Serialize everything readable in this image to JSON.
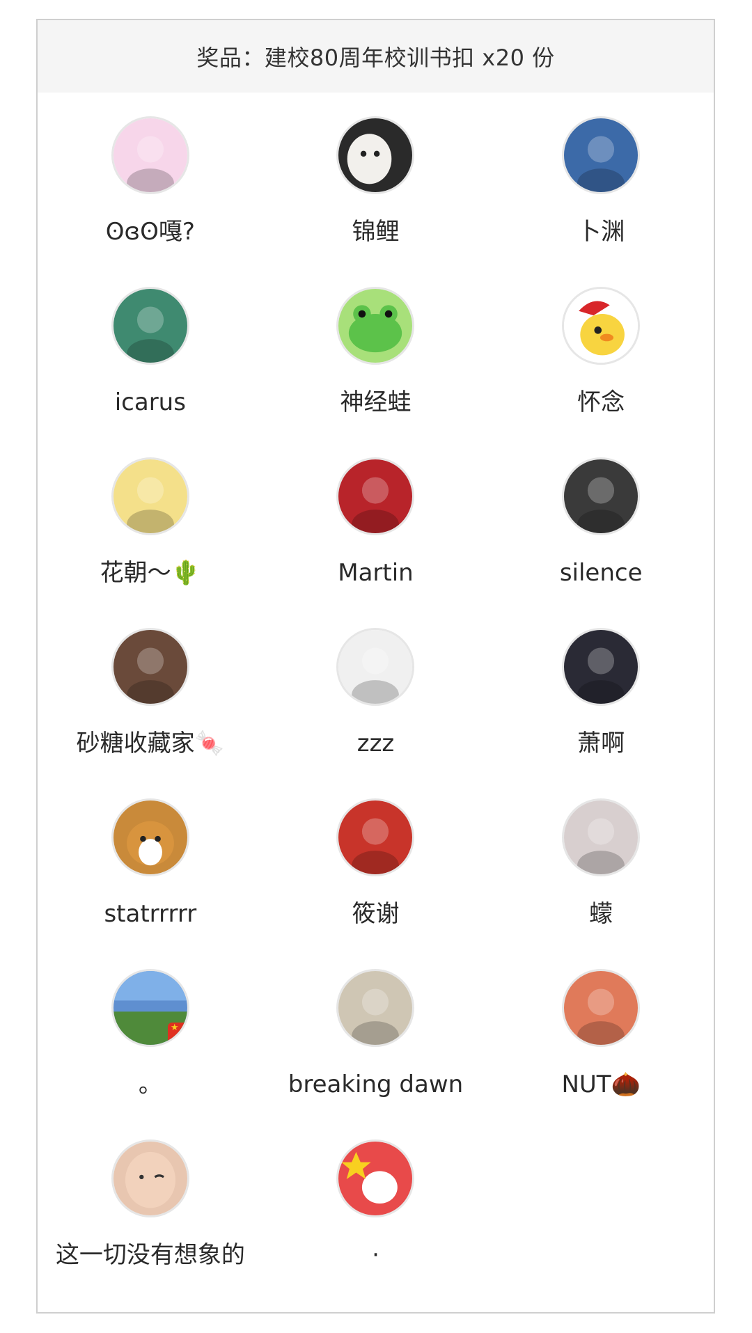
{
  "prize": {
    "text": "奖品：建校80周年校训书扣 x20 份"
  },
  "winners": [
    {
      "name": "ʘɞʘ嘎?",
      "avatar_icon": "anime-stickers-avatar",
      "avatar_color": "#f7d6ea"
    },
    {
      "name": "锦鲤",
      "avatar_icon": "white-cat-avatar",
      "avatar_color": "#2a2a2a"
    },
    {
      "name": "卜渊",
      "avatar_icon": "floating-tower-avatar",
      "avatar_color": "#3c6aa8"
    },
    {
      "name": "icarus",
      "avatar_icon": "anime-boy-avatar",
      "avatar_color": "#3f8a70"
    },
    {
      "name": "神经蛙",
      "avatar_icon": "green-frog-avatar",
      "avatar_color": "#a8e07a"
    },
    {
      "name": "怀念",
      "avatar_icon": "yellow-duck-santa-hat-avatar",
      "avatar_color": "#ffffff"
    },
    {
      "name": "花朝～🌵",
      "avatar_icon": "cartoon-girl-avatar",
      "avatar_color": "#f4e08a"
    },
    {
      "name": "Martin",
      "avatar_icon": "academy-seal-avatar",
      "avatar_color": "#b8242a"
    },
    {
      "name": "silence",
      "avatar_icon": "teddy-bear-avatar",
      "avatar_color": "#3a3a3a"
    },
    {
      "name": "砂糖收藏家🍬",
      "avatar_icon": "girl-portrait-avatar",
      "avatar_color": "#6a4a3a"
    },
    {
      "name": "zzz",
      "avatar_icon": "pixel-sunglasses-avatar",
      "avatar_color": "#f0f0f0"
    },
    {
      "name": "萧啊",
      "avatar_icon": "city-night-avatar",
      "avatar_color": "#2a2a35"
    },
    {
      "name": "statrrrrr",
      "avatar_icon": "corgi-avatar",
      "avatar_color": "#c98a3a"
    },
    {
      "name": "筱谢",
      "avatar_icon": "baby-red-hood-avatar",
      "avatar_color": "#c8342a"
    },
    {
      "name": "蠓",
      "avatar_icon": "hooded-face-avatar",
      "avatar_color": "#d8cfcf"
    },
    {
      "name": "。",
      "avatar_icon": "campus-gate-avatar",
      "avatar_color": "#5f8fd0",
      "badge": true
    },
    {
      "name": "breaking dawn",
      "avatar_icon": "man-silhouette-avatar",
      "avatar_color": "#cfc6b4"
    },
    {
      "name": "NUT🌰",
      "avatar_icon": "cat-crown-avatar",
      "avatar_color": "#e07a5a"
    },
    {
      "name": "这一切没有想象的",
      "avatar_icon": "baby-face-avatar",
      "avatar_color": "#e8c6b0"
    },
    {
      "name": "·",
      "avatar_icon": "bunny-stars-avatar",
      "avatar_color": "#e84a4a"
    }
  ]
}
